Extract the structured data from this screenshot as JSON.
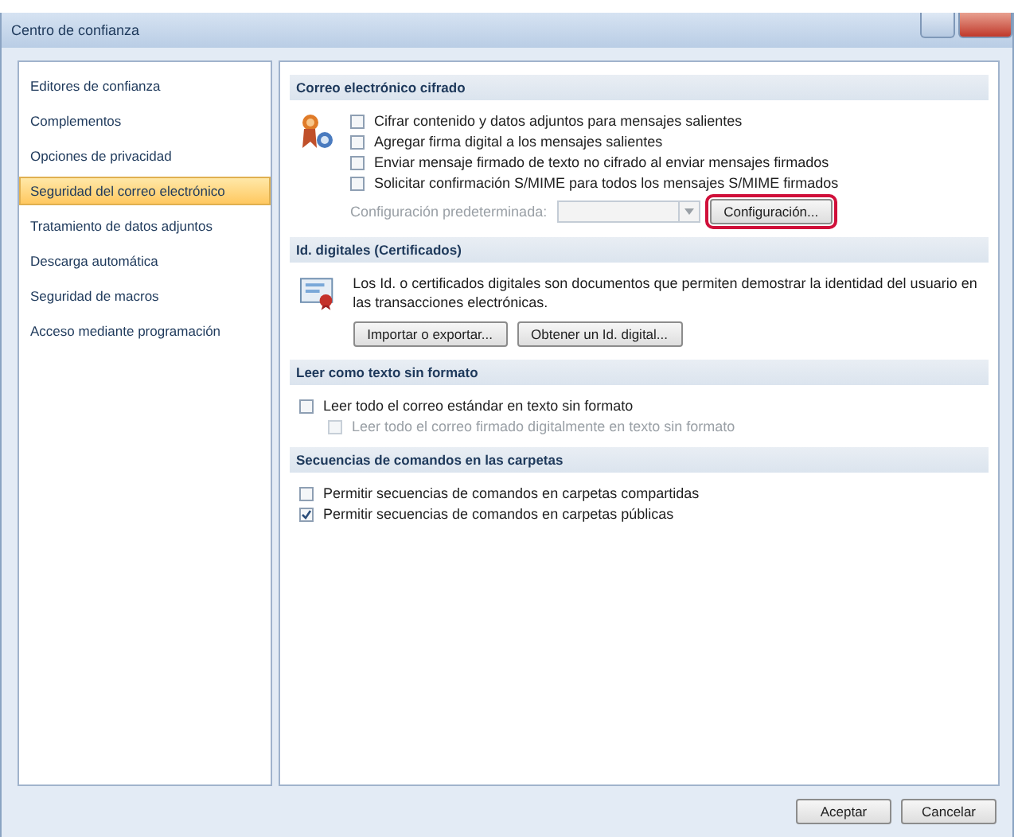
{
  "window": {
    "title": "Centro de confianza"
  },
  "sidebar": {
    "items": [
      {
        "label": "Editores de confianza",
        "selected": false
      },
      {
        "label": "Complementos",
        "selected": false
      },
      {
        "label": "Opciones de privacidad",
        "selected": false
      },
      {
        "label": "Seguridad del correo electrónico",
        "selected": true
      },
      {
        "label": "Tratamiento de datos adjuntos",
        "selected": false
      },
      {
        "label": "Descarga automática",
        "selected": false
      },
      {
        "label": "Seguridad de macros",
        "selected": false
      },
      {
        "label": "Acceso mediante programación",
        "selected": false
      }
    ]
  },
  "sections": [
    {
      "kind": "encryption",
      "title": "Correo electrónico cifrado",
      "options": [
        {
          "label": "Cifrar contenido y datos adjuntos para mensajes salientes",
          "checked": false,
          "disabled": false
        },
        {
          "label": "Agregar firma digital a los mensajes salientes",
          "checked": false,
          "disabled": false
        },
        {
          "label": "Enviar mensaje firmado de texto no cifrado al enviar mensajes firmados",
          "checked": false,
          "disabled": false
        },
        {
          "label": "Solicitar confirmación S/MIME para todos los mensajes S/MIME firmados",
          "checked": false,
          "disabled": false
        }
      ],
      "default_setting": {
        "label": "Configuración predeterminada:",
        "disabled": true
      },
      "settings_button": {
        "label": "Configuración...",
        "highlighted": true
      }
    },
    {
      "kind": "certificates",
      "title": "Id. digitales (Certificados)",
      "description": "Los Id. o certificados digitales son documentos que permiten demostrar la identidad del usuario en las transacciones electrónicas.",
      "buttons": [
        "Importar o exportar...",
        "Obtener un Id. digital..."
      ]
    },
    {
      "kind": "options",
      "title": "Leer como texto sin formato",
      "options": [
        {
          "label": "Leer todo el correo estándar en texto sin formato",
          "checked": false,
          "disabled": false,
          "children": [
            {
              "label": "Leer todo el correo firmado digitalmente en texto sin formato",
              "checked": false,
              "disabled": true
            }
          ]
        }
      ]
    },
    {
      "kind": "options",
      "title": "Secuencias de comandos en las carpetas",
      "options": [
        {
          "label": "Permitir secuencias de comandos en carpetas compartidas",
          "checked": false,
          "disabled": false
        },
        {
          "label": "Permitir secuencias de comandos en carpetas públicas",
          "checked": true,
          "disabled": false
        }
      ]
    }
  ],
  "buttons": [
    "Aceptar",
    "Cancelar"
  ]
}
